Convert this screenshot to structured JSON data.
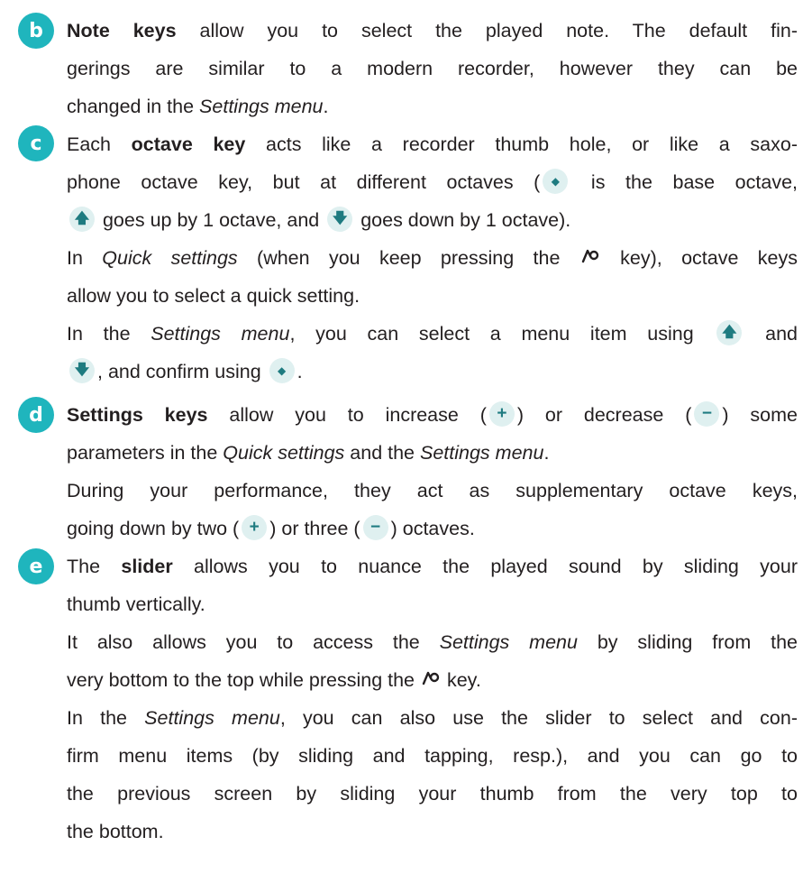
{
  "colors": {
    "badge": "#1fb5bd",
    "chip_bg": "#dff0f0",
    "chip_fg": "#1e7b80",
    "text": "#231f20"
  },
  "icons": {
    "base": "diamond-icon",
    "up": "arrow-up-icon",
    "down": "arrow-down-icon",
    "plus": "plus-icon",
    "minus": "minus-icon",
    "func": "wave-key-icon"
  },
  "glyphs": {
    "diamond": "◆",
    "up": "🡅",
    "down": "🡇",
    "plus": "+",
    "minus": "−"
  },
  "items": {
    "b": {
      "badge": "b",
      "bold": "Note keys",
      "l1": " allow you to select the played note.  The default fin-",
      "l2": "gerings are similar to a modern recorder, however they can be",
      "l3a": "changed in the ",
      "l3em": "Settings menu",
      "l3b": "."
    },
    "c": {
      "badge": "c",
      "l1a": "Each ",
      "bold": "octave key",
      "l1b": " acts like a recorder thumb hole, or like a saxo-",
      "l2a": "phone octave key, but at different octaves (",
      "l2b": " is the base octave,",
      "l3a": " goes up by 1 octave, and ",
      "l3b": " goes down by 1 octave).",
      "l4a": "In ",
      "l4em": "Quick settings",
      "l4b": " (when you keep pressing the ",
      "l4c": " key), octave keys",
      "l5": "allow you to select a quick setting.",
      "l6a": "In the ",
      "l6em": "Settings menu",
      "l6b": ", you can select a menu item using ",
      "l6c": " and",
      "l7a": ", and confirm using ",
      "l7b": "."
    },
    "d": {
      "badge": "d",
      "bold": "Settings keys",
      "l1a": " allow you to increase (",
      "l1b": ") or decrease (",
      "l1c": ") some",
      "l2a": "parameters in the ",
      "l2em1": "Quick settings",
      "l2b": " and the ",
      "l2em2": "Settings menu",
      "l2c": ".",
      "l3": "During your performance, they act as supplementary octave keys,",
      "l4a": "going down by two (",
      "l4b": ") or three (",
      "l4c": ") octaves."
    },
    "e": {
      "badge": "e",
      "l1a": "The ",
      "bold": "slider",
      "l1b": " allows you to nuance the played sound by sliding your",
      "l2": "thumb vertically.",
      "l3a": "It also allows you to access the ",
      "l3em": "Settings menu",
      "l3b": " by sliding from the",
      "l4a": "very bottom to the top while pressing the ",
      "l4b": " key.",
      "l5a": "In the ",
      "l5em": "Settings menu",
      "l5b": ", you can also use the slider to select and con-",
      "l6": "firm menu items (by sliding and tapping, resp.), and you can go to",
      "l7": "the previous screen by sliding your thumb from the very top to",
      "l8": "the bottom."
    }
  }
}
